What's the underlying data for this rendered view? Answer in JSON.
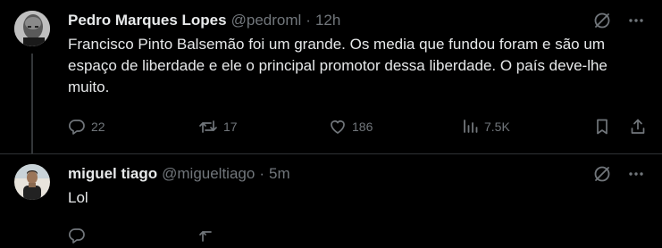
{
  "tweets": [
    {
      "author_name": "Pedro Marques Lopes",
      "handle": "@pedroml",
      "separator": "·",
      "time": "12h",
      "text": "Francisco Pinto Balsemão foi um grande. Os media que fundou foram e são um espaço de liberdade e ele o principal promotor dessa liberdade. O país deve-lhe muito.",
      "stats": {
        "replies": "22",
        "reposts": "17",
        "likes": "186",
        "views": "7.5K"
      },
      "icons": [
        "grok-icon",
        "more-icon",
        "reply-icon",
        "repost-icon",
        "like-icon",
        "views-icon",
        "bookmark-icon",
        "share-icon"
      ]
    },
    {
      "author_name": "miguel tiago",
      "handle": "@migueltiago",
      "separator": "·",
      "time": "5m",
      "text": "Lol",
      "icons": [
        "grok-icon",
        "more-icon"
      ]
    }
  ],
  "colors": {
    "background": "#000000",
    "text_primary": "#e7e9ea",
    "text_secondary": "#71767b",
    "divider": "#2f3336"
  }
}
